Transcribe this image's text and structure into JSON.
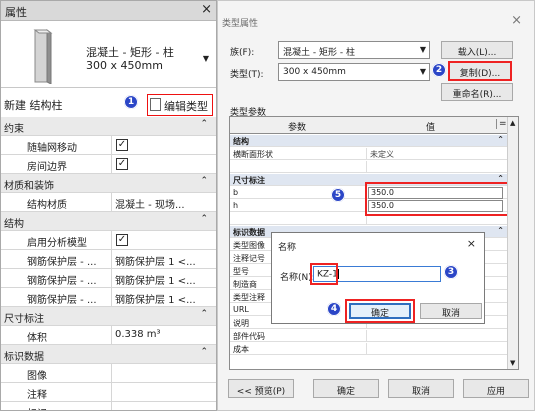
{
  "properties": {
    "title": "属性",
    "close": "×",
    "type_name_line1": "混凝土 - 矩形 - 柱",
    "type_name_line2": "300 x 450mm",
    "instance_label": "新建 结构柱",
    "edit_type_label": "编辑类型",
    "rows": [
      {
        "kind": "group",
        "label": "约束",
        "chev": "⌃"
      },
      {
        "kind": "item",
        "label": "随轴网移动",
        "value": "",
        "check": "✓"
      },
      {
        "kind": "item",
        "label": "房间边界",
        "value": "",
        "check": "✓"
      },
      {
        "kind": "group",
        "label": "材质和装饰",
        "chev": "⌃"
      },
      {
        "kind": "item",
        "label": "结构材质",
        "value": "混凝土 - 现场..."
      },
      {
        "kind": "group",
        "label": "结构",
        "chev": "⌃"
      },
      {
        "kind": "item",
        "label": "启用分析模型",
        "value": "",
        "check": "✓"
      },
      {
        "kind": "item",
        "label": "钢筋保护层 - ...",
        "value": "钢筋保护层 1 <..."
      },
      {
        "kind": "item",
        "label": "钢筋保护层 - ...",
        "value": "钢筋保护层 1 <..."
      },
      {
        "kind": "item",
        "label": "钢筋保护层 - ...",
        "value": "钢筋保护层 1 <..."
      },
      {
        "kind": "group",
        "label": "尺寸标注",
        "chev": "⌃"
      },
      {
        "kind": "item",
        "label": "体积",
        "value": "0.338 m³"
      },
      {
        "kind": "group",
        "label": "标识数据",
        "chev": "⌃"
      },
      {
        "kind": "item",
        "label": "图像",
        "value": ""
      },
      {
        "kind": "item",
        "label": "注释",
        "value": ""
      },
      {
        "kind": "item",
        "label": "标记",
        "value": ""
      }
    ]
  },
  "type_dialog": {
    "title": "类型属性",
    "close": "×",
    "family_label": "族(F):",
    "family_value": "混凝土 - 矩形 - 柱",
    "type_label": "类型(T):",
    "type_value": "300 x 450mm",
    "load_button": "载入(L)...",
    "duplicate_button": "复制(D)...",
    "rename_button": "重命名(R)...",
    "type_params_label": "类型参数",
    "col_param": "参数",
    "col_value": "值",
    "col_eq": "=",
    "rows": [
      {
        "kind": "group",
        "label": "结构",
        "value": ""
      },
      {
        "kind": "item",
        "label": "横断面形状",
        "value": "未定义"
      },
      {
        "kind": "blank",
        "label": "",
        "value": ""
      },
      {
        "kind": "group",
        "label": "尺寸标注",
        "value": ""
      },
      {
        "kind": "item",
        "label": "b",
        "value": ""
      },
      {
        "kind": "item",
        "label": "h",
        "value": ""
      },
      {
        "kind": "blank",
        "label": "",
        "value": ""
      },
      {
        "kind": "group",
        "label": "标识数据",
        "value": ""
      },
      {
        "kind": "item",
        "label": "类型图像",
        "value": ""
      },
      {
        "kind": "item",
        "label": "注释记号",
        "value": ""
      },
      {
        "kind": "item",
        "label": "型号",
        "value": ""
      },
      {
        "kind": "item",
        "label": "制造商",
        "value": ""
      },
      {
        "kind": "item",
        "label": "类型注释",
        "value": ""
      },
      {
        "kind": "item",
        "label": "URL",
        "value": ""
      },
      {
        "kind": "item",
        "label": "说明",
        "value": ""
      },
      {
        "kind": "item",
        "label": "部件代码",
        "value": ""
      },
      {
        "kind": "item",
        "label": "成本",
        "value": ""
      }
    ],
    "b_value": "350.0",
    "h_value": "350.0",
    "preview_button": "<< 预览(P)",
    "ok_button": "确定",
    "cancel_button": "取消",
    "apply_button": "应用"
  },
  "name_dialog": {
    "title": "名称",
    "close": "×",
    "name_label": "名称(N):",
    "name_value": "KZ-1",
    "ok": "确定",
    "cancel": "取消"
  },
  "callouts": [
    "1",
    "2",
    "3",
    "4",
    "5"
  ],
  "colors": {
    "callout": "#2b46c7",
    "highlight": "#e22222",
    "group_bg": "#dfe6f1"
  }
}
